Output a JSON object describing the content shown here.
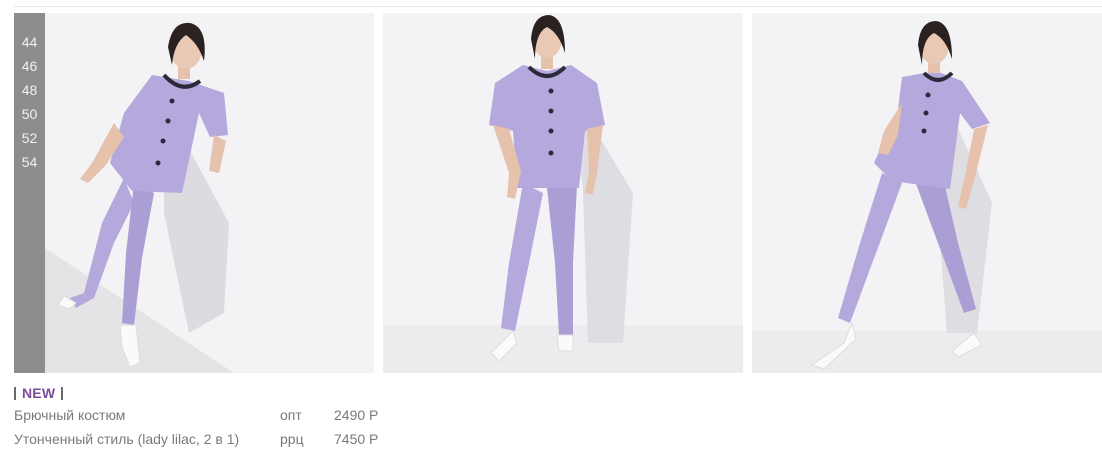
{
  "product": {
    "sizes": [
      "44",
      "46",
      "48",
      "50",
      "52",
      "54"
    ],
    "badge": "NEW",
    "name_line1": "Брючный костюм",
    "name_line2": "Утонченный стиль (lady lilac, 2 в 1)",
    "price_wholesale_label": "опт",
    "price_wholesale": "2490 Р",
    "price_retail_label": "ррц",
    "price_retail": "7450 Р"
  },
  "colors": {
    "suit": "#b5a8dc",
    "badge": "#7b4d9b",
    "sizes_bg": "#8d8d8d"
  }
}
